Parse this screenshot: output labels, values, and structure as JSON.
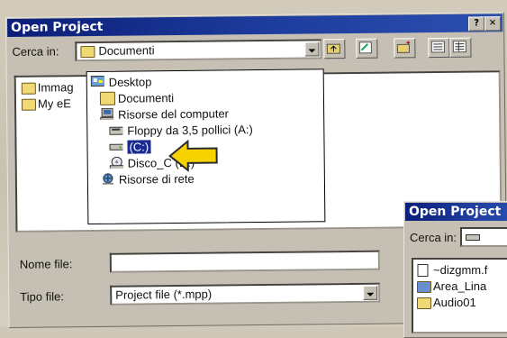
{
  "dialog": {
    "title": "Open Project",
    "help_btn": "?",
    "close_btn": "✕",
    "look_in_label": "Cerca in:",
    "look_in_value": "Documenti",
    "file_name_label": "Nome file:",
    "file_name_value": "",
    "file_type_label": "Tipo file:",
    "file_type_value": "Project file (*.mpp)",
    "background_items": [
      "Immag",
      "My eE"
    ]
  },
  "dropdown": {
    "items": [
      {
        "label": "Desktop",
        "icon": "desktop-icon"
      },
      {
        "label": "Documenti",
        "icon": "folder-open-icon"
      },
      {
        "label": "Risorse del computer",
        "icon": "computer-icon"
      },
      {
        "label": "Floppy da 3,5 pollici (A:)",
        "icon": "floppy-icon"
      },
      {
        "label": "(C:)",
        "icon": "hard-drive-icon",
        "selected": true
      },
      {
        "label": "Disco_C (D:)",
        "icon": "cd-drive-icon"
      },
      {
        "label": "Risorse di rete",
        "icon": "network-icon"
      }
    ]
  },
  "second_dialog": {
    "title": "Open Project",
    "look_in_label": "Cerca in:",
    "files": [
      "~dizgmm.f",
      "Area_Lina",
      "Audio01"
    ]
  },
  "colors": {
    "title_bar": "#0b1f78",
    "selection": "#1a2a8e",
    "arrow": "#f5d200"
  }
}
